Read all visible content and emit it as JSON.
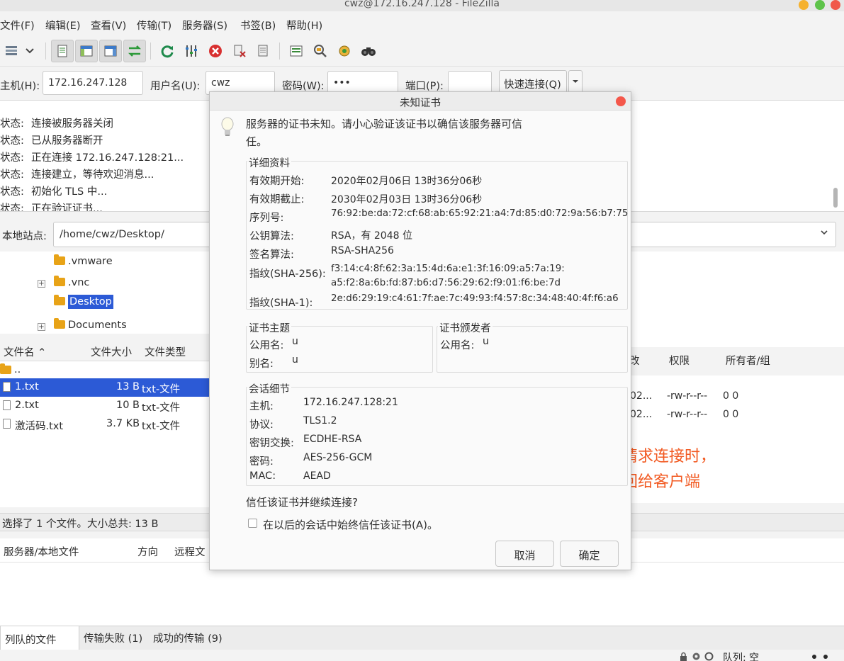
{
  "window": {
    "title": "cwz@172.16.247.128 - FileZilla",
    "button_colors": [
      "#f5b12d",
      "#5ec34a",
      "#f0584b"
    ]
  },
  "menu": [
    "文件(F)",
    "编辑(E)",
    "查看(V)",
    "传输(T)",
    "服务器(S)",
    "书签(B)",
    "帮助(H)"
  ],
  "toolbar": {
    "icons": [
      "site-manager-icon",
      "dropdown-arrow-icon",
      "toggle-log-icon",
      "toggle-local-tree-icon",
      "toggle-remote-tree-icon",
      "toggle-queue-icon",
      "refresh-icon",
      "process-queue-icon",
      "cancel-icon",
      "disconnect-icon",
      "reconnect-icon",
      "filter-icon",
      "compare-icon",
      "sync-browse-icon",
      "search-icon"
    ]
  },
  "quickconnect": {
    "host_label": "主机(H):",
    "host_value": "172.16.247.128",
    "user_label": "用户名(U):",
    "user_value": "cwz",
    "pass_label": "密码(W):",
    "pass_value": "•••",
    "port_label": "端口(P):",
    "port_value": "",
    "button": "快速连接(Q)"
  },
  "log": [
    {
      "label": "状态:",
      "text": "连接被服务器关闭"
    },
    {
      "label": "状态:",
      "text": "已从服务器断开"
    },
    {
      "label": "状态:",
      "text": "正在连接 172.16.247.128:21..."
    },
    {
      "label": "状态:",
      "text": "连接建立，等待欢迎消息..."
    },
    {
      "label": "状态:",
      "text": "初始化 TLS 中..."
    },
    {
      "label": "状态:",
      "text": "正在验证证书..."
    }
  ],
  "local": {
    "label": "本地站点:",
    "path": "/home/cwz/Desktop/",
    "tree": [
      ".vmware",
      ".vnc",
      "Desktop",
      "Documents"
    ]
  },
  "local_files": {
    "columns": [
      "文件名",
      "文件大小",
      "文件类型"
    ],
    "parent": "..",
    "rows": [
      {
        "name": "1.txt",
        "size": "13 B",
        "type": "txt-文件"
      },
      {
        "name": "2.txt",
        "size": "10 B",
        "type": "txt-文件"
      },
      {
        "name": "激活码.txt",
        "size": "3.7 KB",
        "type": "txt-文件"
      }
    ]
  },
  "remote_files": {
    "columns": [
      "改",
      "权限",
      "所有者/组"
    ],
    "rows": [
      {
        "date": "02...",
        "perm": "-rw-r--r--",
        "owner": "0 0"
      },
      {
        "date": "02...",
        "perm": "-rw-r--r--",
        "owner": "0 0"
      }
    ]
  },
  "status_text": "选择了 1 个文件。大小总共: 13 B",
  "queue": {
    "columns": [
      "服务器/本地文件",
      "方向",
      "远程文"
    ],
    "tabs": [
      "列队的文件",
      "传输失败 (1)",
      "成功的传输 (9)"
    ],
    "status": "队列: 空"
  },
  "dialog": {
    "title": "未知证书",
    "intro_line1": "服务器的证书未知。请小心验证该证书以确信该服务器可信",
    "intro_line2": "任。",
    "details": {
      "title": "详细资料",
      "valid_from_label": "有效期开始:",
      "valid_from": "2020年02月06日 13时36分06秒",
      "valid_to_label": "有效期截止:",
      "valid_to": "2030年02月03日 13时36分06秒",
      "serial_label": "序列号:",
      "serial": "76:92:be:da:72:cf:68:ab:65:92:21:a4:7d:85:d0:72:9a:56:b7:75",
      "pubkey_label": "公钥算法:",
      "pubkey": "RSA，有 2048 位",
      "sigalg_label": "签名算法:",
      "sigalg": "RSA-SHA256",
      "sha256_label": "指纹(SHA-256):",
      "sha256_line1": "f3:14:c4:8f:62:3a:15:4d:6a:e1:3f:16:09:a5:7a:19:",
      "sha256_line2": "a5:f2:8a:6b:fd:87:b6:d7:56:29:62:f9:01:f6:be:7d",
      "sha1_label": "指纹(SHA-1):",
      "sha1": "2e:d6:29:19:c4:61:7f:ae:7c:49:93:f4:57:8c:34:48:40:4f:f6:a6"
    },
    "subject": {
      "title": "证书主题",
      "cn_label": "公用名:",
      "cn": "u",
      "alt_label": "别名:",
      "alt": "u"
    },
    "issuer": {
      "title": "证书颁发者",
      "cn_label": "公用名:",
      "cn": "u"
    },
    "session": {
      "title": "会话细节",
      "host_label": "主机:",
      "host": "172.16.247.128:21",
      "proto_label": "协议:",
      "proto": "TLS1.2",
      "kex_label": "密钥交换:",
      "kex": "ECDHE-RSA",
      "cipher_label": "密码:",
      "cipher": "AES-256-GCM",
      "mac_label": "MAC:",
      "mac": "AEAD"
    },
    "question": "信任该证书并继续连接?",
    "always_trust": "在以后的会话中始终信任该证书(A)。",
    "cancel": "取消",
    "ok": "确定"
  },
  "annotation": {
    "line1": "当客户端向服务器发送加密请求连接时，",
    "line2": "服务器把加密的公钥证书返回给客户端",
    "color": "#f25a22"
  },
  "colors": {
    "selection": "#2c5ad6",
    "folder": "#e8a317"
  }
}
